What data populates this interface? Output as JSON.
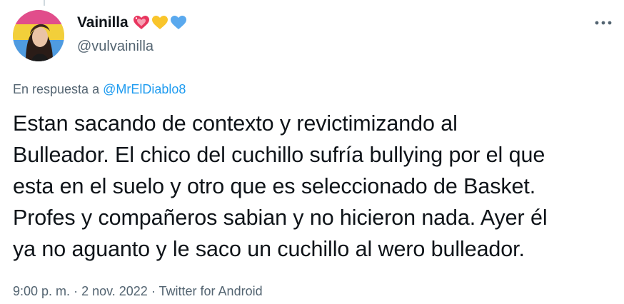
{
  "author": {
    "display_name": "Vainilla",
    "handle": "@vulvainilla",
    "emoji_icons": [
      "sparkling-heart-icon",
      "yellow-heart-icon",
      "blue-heart-icon"
    ],
    "emoji_colors": [
      "#e8365f",
      "#f9c52b",
      "#5aa9ee"
    ]
  },
  "reply": {
    "prefix": "En respuesta a",
    "mention": "@MrElDiablo8"
  },
  "tweet": {
    "lines": [
      "Estan sacando de contexto y revictimizando al",
      "Bulleador. El chico del cuchillo sufría bullying por el que",
      "esta en el suelo y otro que es seleccionado de Basket.",
      "Profes y compañeros sabian y no hicieron nada. Ayer él",
      "ya no aguanto y le saco un cuchillo al wero bulleador."
    ]
  },
  "meta": {
    "time": "9:00 p. m.",
    "sep1": "·",
    "date": "2 nov. 2022",
    "sep2": "·",
    "source": "Twitter for Android"
  },
  "colors": {
    "link": "#1d9bf0",
    "secondary_text": "#536471",
    "primary_text": "#0f1419"
  }
}
